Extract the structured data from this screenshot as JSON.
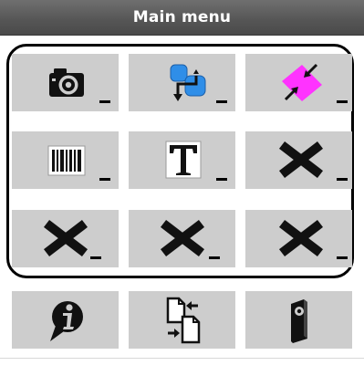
{
  "header": {
    "title": "Main menu"
  },
  "grid": {
    "tiles": [
      {
        "icon": "camera-icon",
        "has_dropdown": true
      },
      {
        "icon": "flowchart-connector-icon",
        "has_dropdown": true
      },
      {
        "icon": "resize-shape-icon",
        "has_dropdown": true
      },
      {
        "icon": "barcode-icon",
        "has_dropdown": true
      },
      {
        "icon": "text-icon",
        "has_dropdown": true
      },
      {
        "icon": "empty-slot-x-icon",
        "has_dropdown": true
      },
      {
        "icon": "empty-slot-x-icon",
        "has_dropdown": true
      },
      {
        "icon": "empty-slot-x-icon",
        "has_dropdown": true
      },
      {
        "icon": "empty-slot-x-icon",
        "has_dropdown": true
      }
    ]
  },
  "bottom_bar": {
    "buttons": [
      {
        "icon": "info-bubble-icon"
      },
      {
        "icon": "swap-pages-icon"
      },
      {
        "icon": "speaker-device-icon"
      }
    ]
  },
  "colors": {
    "titlebar": "#555555",
    "tile": "#cdcdcd",
    "frame": "#000000",
    "accent_blue": "#2f8ee8",
    "accent_magenta": "#ff33ff"
  }
}
